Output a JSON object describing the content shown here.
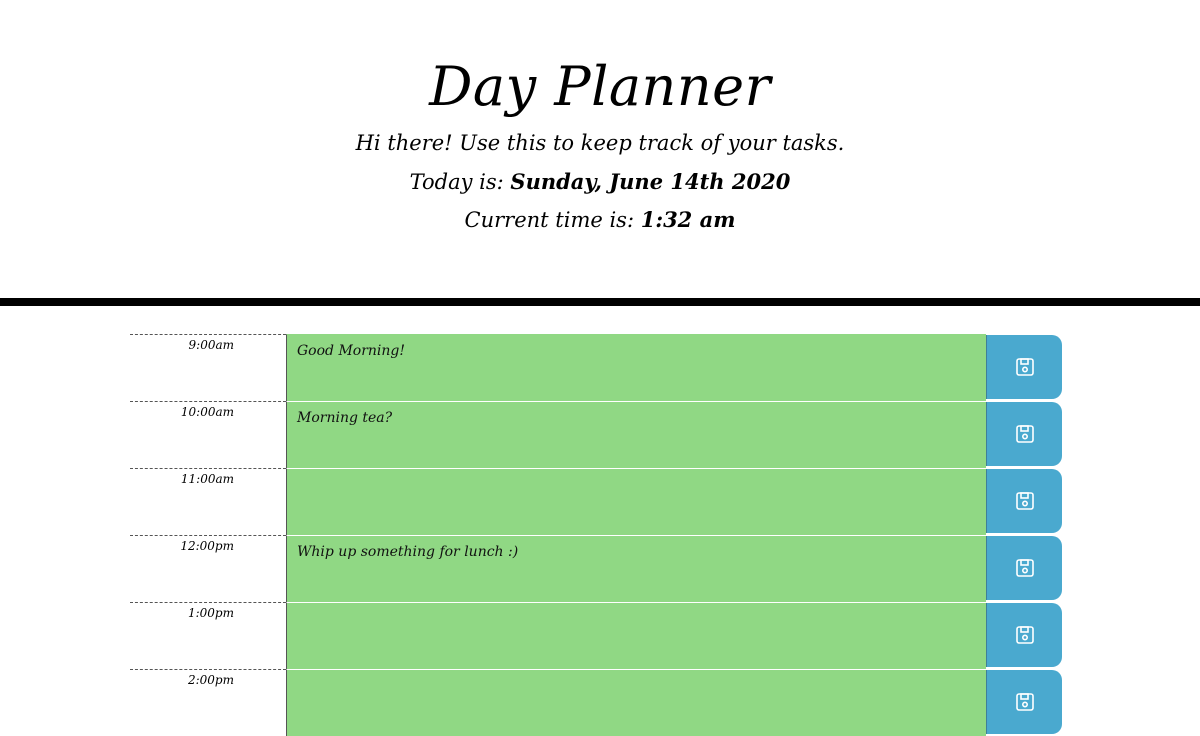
{
  "header": {
    "title": "Day Planner",
    "intro": "Hi there! Use this to keep track of your tasks.",
    "date_prefix": "Today is: ",
    "date_value": "Sunday, June 14th 2020",
    "time_prefix": "Current time is: ",
    "time_value": "1:32 am"
  },
  "colors": {
    "task_present_bg": "#90d884",
    "save_button_bg": "#4aa9cf",
    "divider": "#000000"
  },
  "rows": [
    {
      "hour": "9:00am",
      "task": "Good Morning!",
      "save_icon": "floppy-disk-icon"
    },
    {
      "hour": "10:00am",
      "task": "Morning tea?",
      "save_icon": "floppy-disk-icon"
    },
    {
      "hour": "11:00am",
      "task": "",
      "save_icon": "floppy-disk-icon"
    },
    {
      "hour": "12:00pm",
      "task": "Whip up something for lunch :)",
      "save_icon": "floppy-disk-icon"
    },
    {
      "hour": "1:00pm",
      "task": "",
      "save_icon": "floppy-disk-icon"
    },
    {
      "hour": "2:00pm",
      "task": "",
      "save_icon": "floppy-disk-icon"
    }
  ]
}
